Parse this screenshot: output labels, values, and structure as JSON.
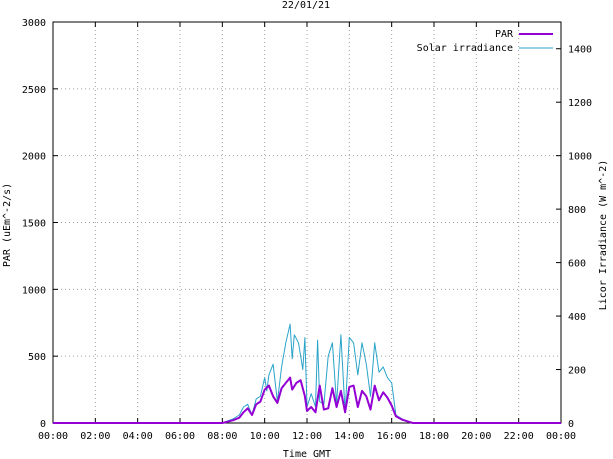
{
  "chart_data": {
    "type": "line",
    "title": "22/01/21",
    "xlabel": "Time GMT",
    "ylabel": "PAR (uEm^-2/s)",
    "y2label": "Licor Irradiance (W m^-2)",
    "x_ticks": [
      "00:00",
      "02:00",
      "04:00",
      "06:00",
      "08:00",
      "10:00",
      "12:00",
      "14:00",
      "16:00",
      "18:00",
      "20:00",
      "22:00",
      "00:00"
    ],
    "xlim_hours": [
      0,
      24
    ],
    "ylim": [
      0,
      3000
    ],
    "y_ticks": [
      0,
      500,
      1000,
      1500,
      2000,
      2500,
      3000
    ],
    "y2lim": [
      0,
      1500
    ],
    "y2_ticks": [
      0,
      200,
      400,
      600,
      800,
      1000,
      1200,
      1400
    ],
    "grid": true,
    "legend_position": "top-right",
    "series": [
      {
        "name": "PAR",
        "axis": "left",
        "color": "#9400d3",
        "x_hours": [
          0,
          8,
          8.5,
          8.8,
          9.0,
          9.2,
          9.4,
          9.6,
          9.8,
          10.0,
          10.2,
          10.4,
          10.6,
          10.8,
          11.0,
          11.2,
          11.3,
          11.5,
          11.7,
          11.9,
          12.0,
          12.2,
          12.4,
          12.6,
          12.8,
          13.0,
          13.2,
          13.4,
          13.6,
          13.8,
          14.0,
          14.2,
          14.4,
          14.6,
          14.8,
          15.0,
          15.2,
          15.4,
          15.6,
          15.8,
          16.0,
          16.2,
          16.5,
          16.8,
          17.0,
          24
        ],
        "values": [
          0,
          0,
          20,
          40,
          80,
          110,
          60,
          140,
          160,
          250,
          280,
          200,
          150,
          260,
          300,
          340,
          250,
          300,
          320,
          200,
          90,
          120,
          80,
          280,
          100,
          110,
          260,
          120,
          240,
          80,
          270,
          280,
          120,
          240,
          200,
          100,
          280,
          170,
          230,
          190,
          130,
          50,
          25,
          10,
          0,
          0
        ]
      },
      {
        "name": "Solar irradiance",
        "axis": "right",
        "color": "#2aa3c9",
        "x_hours": [
          0,
          8,
          8.5,
          8.8,
          9.0,
          9.2,
          9.4,
          9.6,
          9.8,
          10.0,
          10.1,
          10.2,
          10.4,
          10.6,
          10.8,
          11.0,
          11.2,
          11.3,
          11.4,
          11.6,
          11.8,
          11.9,
          12.0,
          12.2,
          12.4,
          12.5,
          12.6,
          12.8,
          13.0,
          13.2,
          13.4,
          13.6,
          13.8,
          14.0,
          14.2,
          14.4,
          14.6,
          14.8,
          15.0,
          15.2,
          15.4,
          15.6,
          15.8,
          16.0,
          16.2,
          16.5,
          16.8,
          17.0,
          24
        ],
        "values": [
          0,
          0,
          15,
          30,
          60,
          70,
          30,
          90,
          100,
          170,
          120,
          180,
          220,
          80,
          210,
          300,
          370,
          240,
          330,
          300,
          200,
          320,
          60,
          110,
          60,
          310,
          80,
          70,
          250,
          300,
          70,
          330,
          40,
          320,
          300,
          180,
          300,
          220,
          100,
          300,
          190,
          210,
          170,
          150,
          30,
          15,
          5,
          0,
          0
        ]
      }
    ]
  }
}
